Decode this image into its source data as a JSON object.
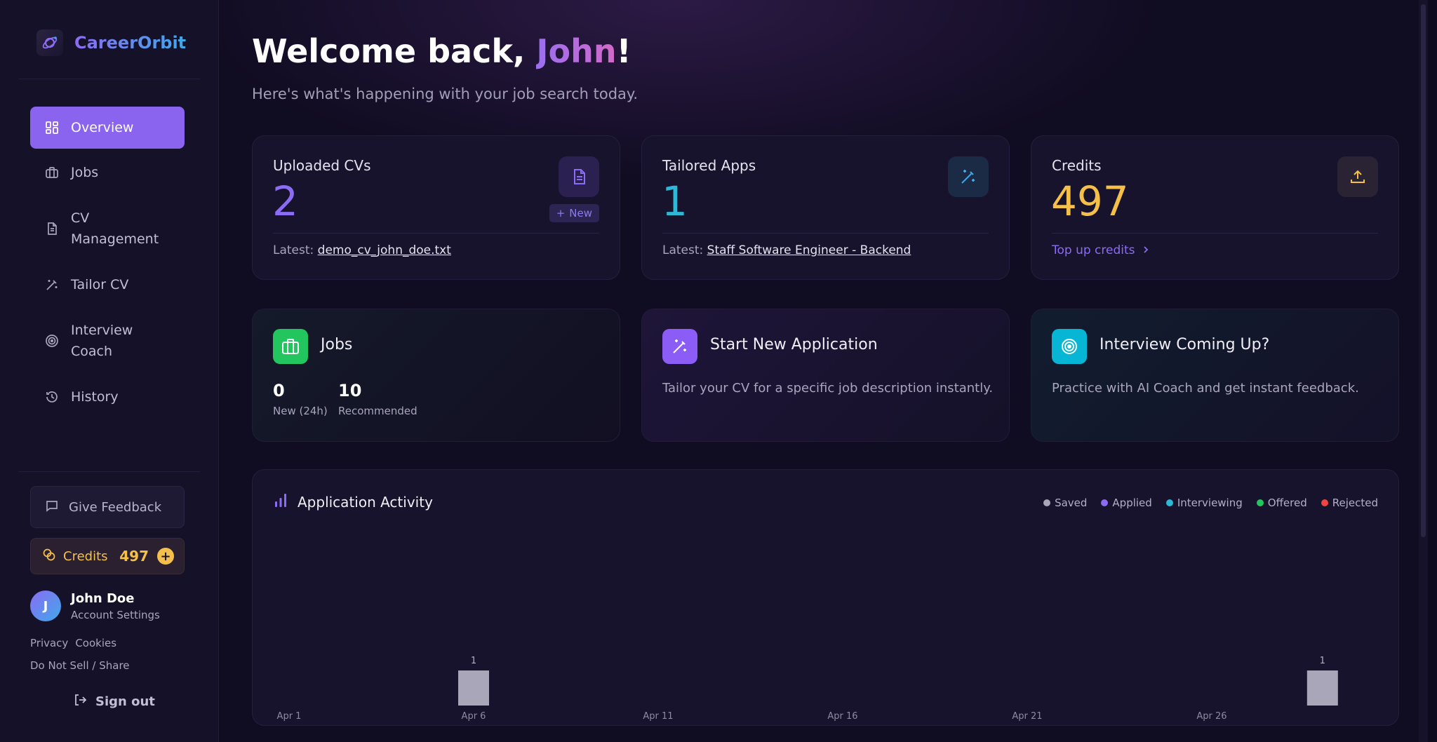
{
  "brand": {
    "name": "CareerOrbit"
  },
  "sidebar": {
    "nav": [
      {
        "label": "Overview",
        "icon": "grid-icon",
        "active": true
      },
      {
        "label": "Jobs",
        "icon": "briefcase-icon"
      },
      {
        "label": "CV Management",
        "icon": "document-icon"
      },
      {
        "label": "Tailor CV",
        "icon": "magic-wand-icon"
      },
      {
        "label": "Interview Coach",
        "icon": "target-icon"
      },
      {
        "label": "History",
        "icon": "history-icon"
      }
    ],
    "feedback_label": "Give Feedback",
    "credits_label": "Credits",
    "credits_value": "497",
    "credits_plus": "+",
    "user": {
      "initial": "J",
      "name": "John Doe",
      "sub": "Account Settings"
    },
    "legal": {
      "privacy": "Privacy",
      "cookies": "Cookies",
      "dns": "Do Not Sell / Share"
    },
    "signout_label": "Sign out"
  },
  "header": {
    "greet_prefix": "Welcome back, ",
    "greet_name": "John",
    "greet_suffix": "!",
    "subtitle": "Here's what's happening with your job search today."
  },
  "cards": {
    "cvs": {
      "title": "Uploaded CVs",
      "value": "2",
      "latest_label": "Latest: ",
      "latest_value": "demo_cv_john_doe.txt",
      "new_label": "New",
      "new_prefix": "+"
    },
    "apps": {
      "title": "Tailored Apps",
      "value": "1",
      "latest_label": "Latest: ",
      "latest_value": "Staff Software Engineer - Backend"
    },
    "credits": {
      "title": "Credits",
      "value": "497",
      "topup_label": "Top up credits"
    }
  },
  "quick": {
    "jobs": {
      "title": "Jobs",
      "new_value": "0",
      "new_label": "New (24h)",
      "rec_value": "10",
      "rec_label": "Recommended"
    },
    "start": {
      "title": "Start New Application",
      "desc": "Tailor your CV for a specific job description instantly."
    },
    "interview": {
      "title": "Interview Coming Up?",
      "desc": "Practice with AI Coach and get instant feedback."
    }
  },
  "colors": {
    "accent": "#8a63ee",
    "cv_value": "#8b6cf5",
    "apps_value": "#2eb8d6",
    "credits_value": "#f5c04a",
    "jobs_icon_bg": "#22c55e",
    "start_icon_bg": "#8b5cf6",
    "interview_icon_bg": "#06b6d4"
  },
  "activity": {
    "title": "Application Activity",
    "legend": [
      {
        "name": "Saved",
        "color": "#a8a6b8"
      },
      {
        "name": "Applied",
        "color": "#8b6cf5"
      },
      {
        "name": "Interviewing",
        "color": "#2eb8d6"
      },
      {
        "name": "Offered",
        "color": "#22c55e"
      },
      {
        "name": "Rejected",
        "color": "#ef4444"
      }
    ]
  },
  "chart_data": {
    "type": "bar",
    "title": "Application Activity",
    "x_ticks": [
      "Apr 1",
      "Apr 6",
      "Apr 11",
      "Apr 16",
      "Apr 21",
      "Apr 26"
    ],
    "x_range": [
      1,
      30
    ],
    "series": [
      {
        "name": "Saved",
        "points": [
          {
            "x": 6,
            "y": 1,
            "label": "1"
          },
          {
            "x": 29,
            "y": 1,
            "label": "1"
          }
        ]
      },
      {
        "name": "Applied",
        "points": []
      },
      {
        "name": "Interviewing",
        "points": []
      },
      {
        "name": "Offered",
        "points": []
      },
      {
        "name": "Rejected",
        "points": []
      }
    ],
    "ylim": [
      0,
      1
    ],
    "grid": false,
    "legend": "top-right"
  }
}
